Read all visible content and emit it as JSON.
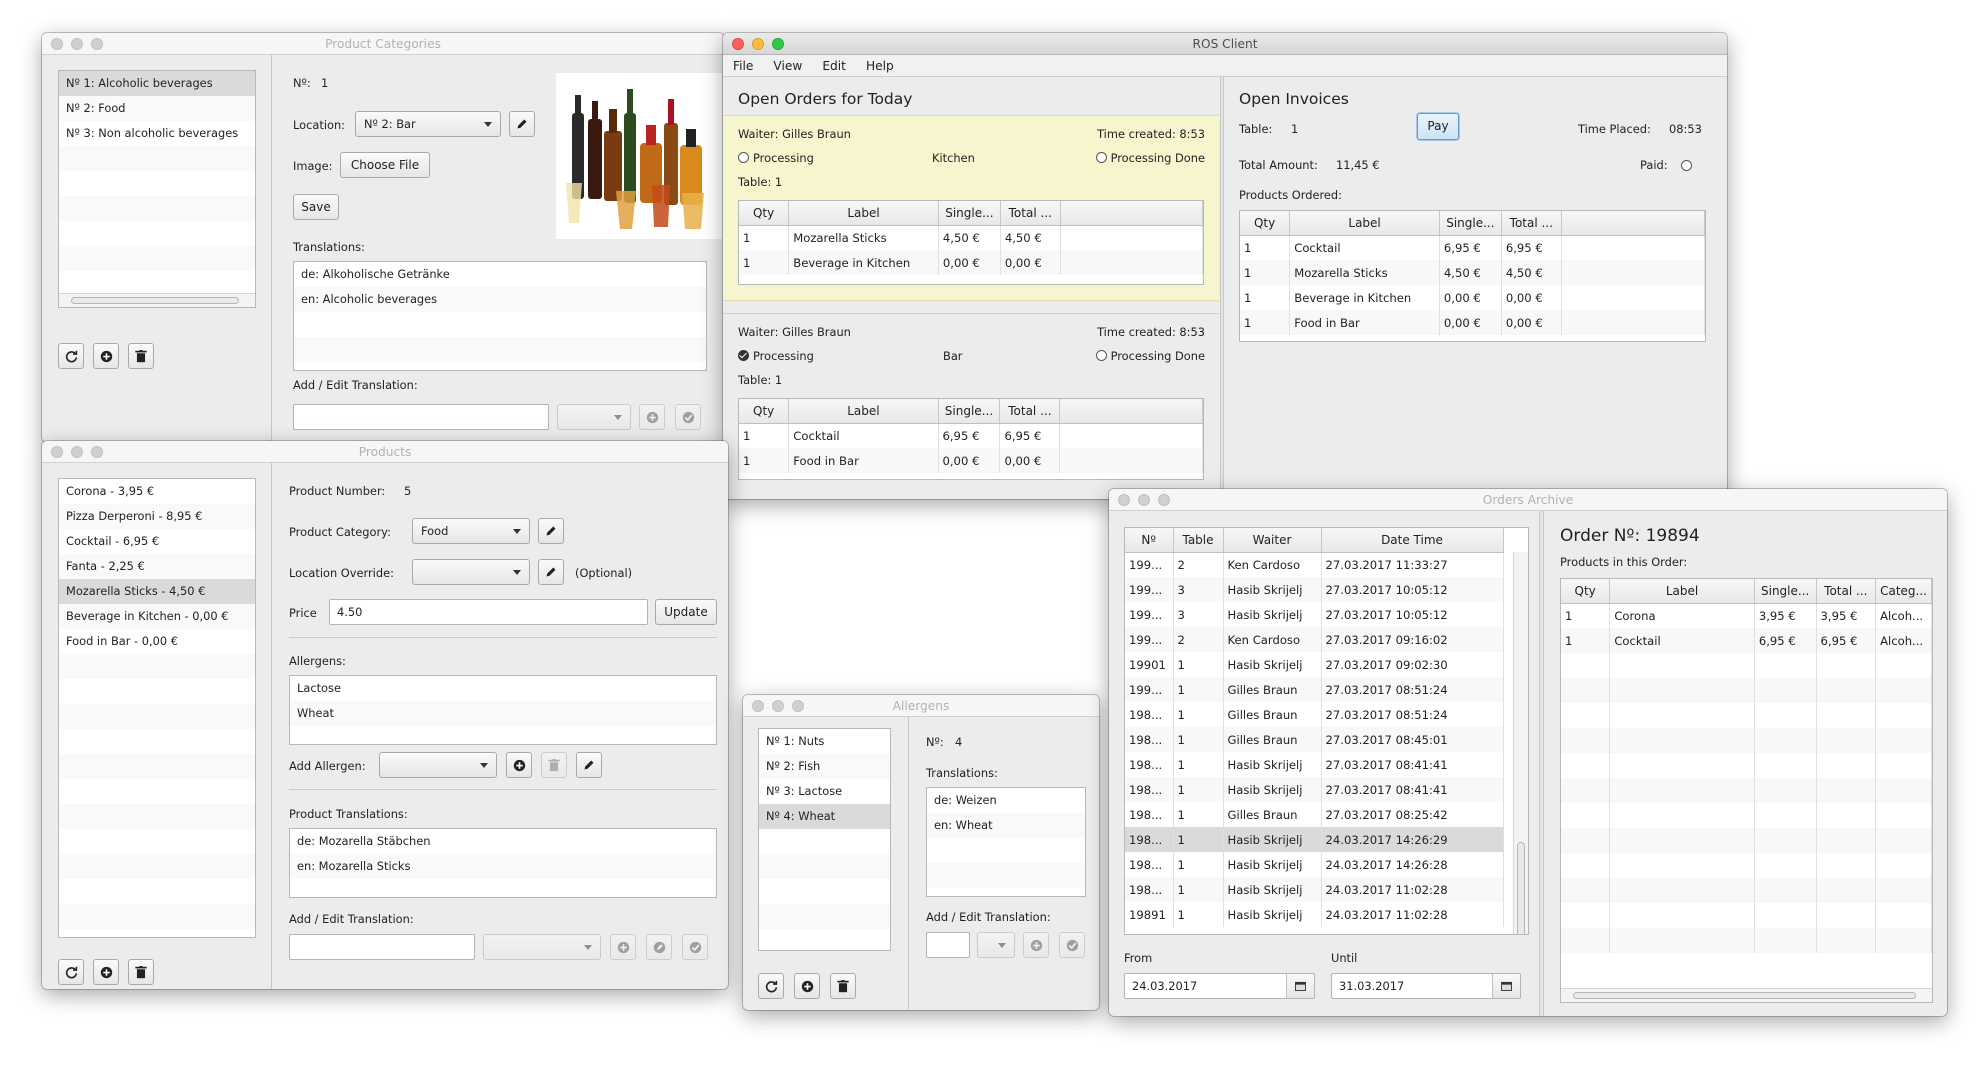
{
  "product_categories": {
    "title": "Product Categories",
    "list": [
      "Nº 1: Alcoholic beverages",
      "Nº 2: Food",
      "Nº 3: Non alcoholic beverages"
    ],
    "number_label": "Nº:",
    "number_value": "1",
    "location_label": "Location:",
    "location_value": "Nº 2: Bar",
    "image_label": "Image:",
    "choose_file": "Choose File",
    "save": "Save",
    "translations_label": "Translations:",
    "translations": [
      "de: Alkoholische Getränke",
      "en: Alcoholic beverages"
    ],
    "add_edit_label": "Add / Edit Translation:"
  },
  "products": {
    "title": "Products",
    "list": [
      "Corona - 3,95 €",
      "Pizza Derperoni - 8,95 €",
      "Cocktail - 6,95 €",
      "Fanta - 2,25 €",
      "Mozarella Sticks - 4,50 €",
      "Beverage in Kitchen - 0,00 €",
      "Food in Bar - 0,00 €"
    ],
    "number_label": "Product Number:",
    "number_value": "5",
    "category_label": "Product Category:",
    "category_value": "Food",
    "location_override_label": "Location Override:",
    "optional": "(Optional)",
    "price_label": "Price",
    "price_value": "4.50",
    "update": "Update",
    "allergens_label": "Allergens:",
    "allergens": [
      "Lactose",
      "Wheat"
    ],
    "add_allergen_label": "Add Allergen:",
    "product_translations_label": "Product Translations:",
    "translations": [
      "de: Mozarella Stäbchen",
      "en: Mozarella Sticks"
    ],
    "add_edit_label": "Add / Edit Translation:"
  },
  "ros_client": {
    "title": "ROS Client",
    "menu": [
      "File",
      "View",
      "Edit",
      "Help"
    ],
    "open_orders_title": "Open Orders for Today",
    "orders": [
      {
        "waiter": "Waiter: Gilles Braun",
        "time_created": "Time created: 8:53",
        "processing": "Processing",
        "location": "Kitchen",
        "processing_done": "Processing Done",
        "table": "Table: 1",
        "rows": [
          [
            "1",
            "Mozarella Sticks",
            "4,50 €",
            "4,50 €"
          ],
          [
            "1",
            "Beverage in Kitchen",
            "0,00 €",
            "0,00 €"
          ]
        ]
      },
      {
        "waiter": "Waiter: Gilles Braun",
        "time_created": "Time created: 8:53",
        "processing": "Processing",
        "location": "Bar",
        "processing_done": "Processing Done",
        "table": "Table: 1",
        "rows": [
          [
            "1",
            "Cocktail",
            "6,95 €",
            "6,95 €"
          ],
          [
            "1",
            "Food in Bar",
            "0,00 €",
            "0,00 €"
          ]
        ]
      }
    ],
    "order_columns": [
      "Qty",
      "Label",
      "Single...",
      "Total ..."
    ],
    "open_invoices_title": "Open Invoices",
    "table_label": "Table:",
    "table_value": "1",
    "pay": "Pay",
    "time_placed_label": "Time Placed:",
    "time_placed_value": "08:53",
    "total_amount_label": "Total Amount:",
    "total_amount_value": "11,45 €",
    "paid_label": "Paid:",
    "products_ordered_label": "Products Ordered:",
    "invoice_rows": [
      [
        "1",
        "Cocktail",
        "6,95 €",
        "6,95 €"
      ],
      [
        "1",
        "Mozarella Sticks",
        "4,50 €",
        "4,50 €"
      ],
      [
        "1",
        "Beverage in Kitchen",
        "0,00 €",
        "0,00 €"
      ],
      [
        "1",
        "Food in Bar",
        "0,00 €",
        "0,00 €"
      ]
    ]
  },
  "allergens": {
    "title": "Allergens",
    "list": [
      "Nº 1: Nuts",
      "Nº 2: Fish",
      "Nº 3: Lactose",
      "Nº 4: Wheat"
    ],
    "number_label": "Nº:",
    "number_value": "4",
    "translations_label": "Translations:",
    "translations": [
      "de: Weizen",
      "en: Wheat"
    ],
    "add_edit_label": "Add / Edit Translation:"
  },
  "orders_archive": {
    "title": "Orders Archive",
    "columns": [
      "Nº",
      "Table",
      "Waiter",
      "Date Time"
    ],
    "rows": [
      [
        "199...",
        "2",
        "Ken Cardoso",
        "27.03.2017 11:33:27"
      ],
      [
        "199...",
        "3",
        "Hasib Skrijelj",
        "27.03.2017 10:05:12"
      ],
      [
        "199...",
        "3",
        "Hasib Skrijelj",
        "27.03.2017 10:05:12"
      ],
      [
        "199...",
        "2",
        "Ken Cardoso",
        "27.03.2017 09:16:02"
      ],
      [
        "19901",
        "1",
        "Hasib Skrijelj",
        "27.03.2017 09:02:30"
      ],
      [
        "199...",
        "1",
        "Gilles Braun",
        "27.03.2017 08:51:24"
      ],
      [
        "198...",
        "1",
        "Gilles Braun",
        "27.03.2017 08:51:24"
      ],
      [
        "198...",
        "1",
        "Gilles Braun",
        "27.03.2017 08:45:01"
      ],
      [
        "198...",
        "1",
        "Hasib Skrijelj",
        "27.03.2017 08:41:41"
      ],
      [
        "198...",
        "1",
        "Hasib Skrijelj",
        "27.03.2017 08:41:41"
      ],
      [
        "198...",
        "1",
        "Gilles Braun",
        "27.03.2017 08:25:42"
      ],
      [
        "198...",
        "1",
        "Hasib Skrijelj",
        "24.03.2017 14:26:29"
      ],
      [
        "198...",
        "1",
        "Hasib Skrijelj",
        "24.03.2017 14:26:28"
      ],
      [
        "198...",
        "1",
        "Hasib Skrijelj",
        "24.03.2017 11:02:28"
      ],
      [
        "19891",
        "1",
        "Hasib Skrijelj",
        "24.03.2017 11:02:28"
      ]
    ],
    "selected_row": 11,
    "from_label": "From",
    "from_value": "24.03.2017",
    "until_label": "Until",
    "until_value": "31.03.2017",
    "order_title": "Order Nº: 19894",
    "products_in_order_label": "Products in this Order:",
    "order_columns": [
      "Qty",
      "Label",
      "Single...",
      "Total ...",
      "Categ..."
    ],
    "order_rows": [
      [
        "1",
        "Corona",
        "3,95 €",
        "3,95 €",
        "Alcoh..."
      ],
      [
        "1",
        "Cocktail",
        "6,95 €",
        "6,95 €",
        "Alcoh..."
      ]
    ]
  }
}
